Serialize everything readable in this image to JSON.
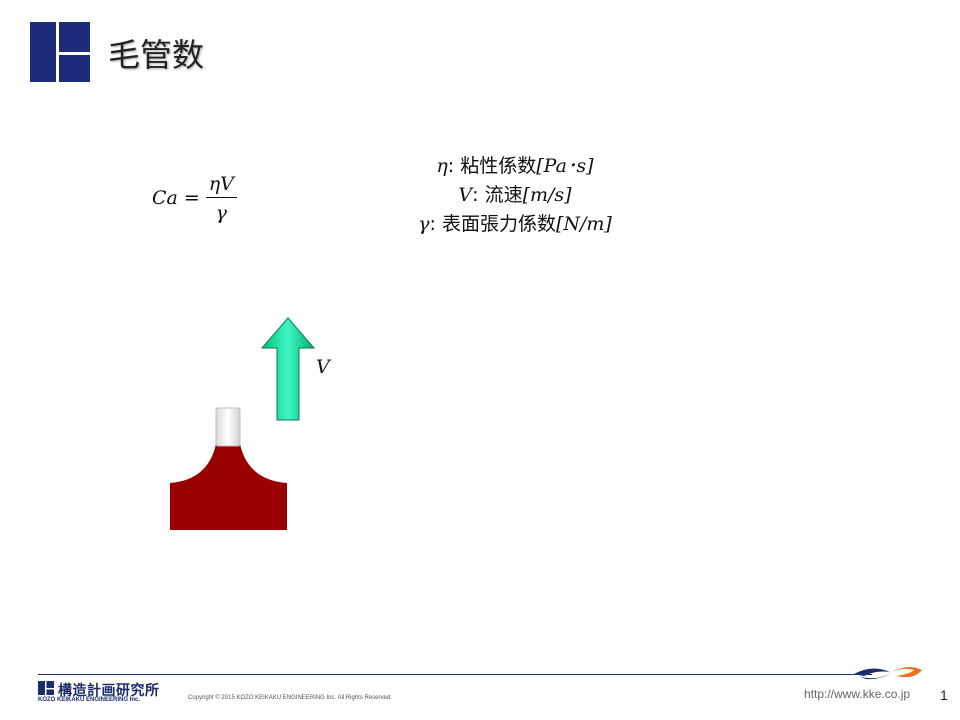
{
  "slide": {
    "title": "毛管数",
    "page_number": "1"
  },
  "formula": {
    "lhs": "Ca",
    "equals": "=",
    "numerator": "ηV",
    "denominator": "γ"
  },
  "definitions": [
    {
      "symbol": "η",
      "separator": ": ",
      "description": "粘性係数",
      "unit": "[Pa･s]"
    },
    {
      "symbol": "V",
      "separator": ": ",
      "description": "流速",
      "unit": "[m/s]"
    },
    {
      "symbol": "γ",
      "separator": ": ",
      "description": "表面張力係数",
      "unit": "[N/m]"
    }
  ],
  "diagram": {
    "velocity_label": "V",
    "colors": {
      "liquid": "#990000",
      "arrow_top": "#1ee8b0",
      "arrow_bottom": "#00c07a",
      "arrow_stroke": "#0a7a55",
      "nozzle": "#e6e6e6"
    }
  },
  "footer": {
    "company_jp": "構造計画研究所",
    "company_en": "KOZO KEIKAKU ENGINEERING Inc.",
    "copyright": "Copyright © 2015 KOZO KEIKAKU ENGINEERING Inc. All Rights Reserved.",
    "url": "http://www.kke.co.jp",
    "colors": {
      "brand_navy": "#1c2b6a",
      "swoosh_orange": "#f07020"
    }
  }
}
